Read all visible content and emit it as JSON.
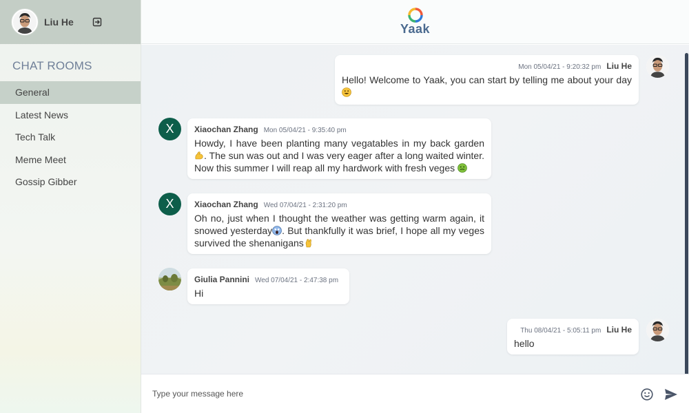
{
  "user": {
    "name": "Liu He"
  },
  "app": {
    "name": "Yaak"
  },
  "sidebar": {
    "title": "CHAT ROOMS",
    "rooms": [
      {
        "label": "General",
        "active": true
      },
      {
        "label": "Latest News"
      },
      {
        "label": "Tech Talk"
      },
      {
        "label": "Meme Meet"
      },
      {
        "label": "Gossip Gibber"
      }
    ]
  },
  "messages": [
    {
      "sender": "Liu He",
      "time": "Mon 05/04/21 - 9:20:32 pm",
      "text": "Hello! Welcome to Yaak, you can start by telling me about your day",
      "emoji": "grinning-face",
      "own": true
    },
    {
      "sender": "Xiaochan Zhang",
      "avatar_letter": "X",
      "time": "Mon 05/04/21 - 9:35:40 pm",
      "text_1": "Howdy, I have been planting many vegatables in my back garden",
      "emoji_1": "flexed-biceps",
      "text_2": ". The sun was out and I was very eager after a long waited winter. Now this summer I will reap all my hardwork with fresh veges",
      "emoji_2": "nauseated-face"
    },
    {
      "sender": "Xiaochan Zhang",
      "avatar_letter": "X",
      "time": "Wed 07/04/21 - 2:31:20 pm",
      "text_1": "Oh no, just when I thought the weather was getting warm again, it snowed yesterday",
      "emoji_1": "screaming-face",
      "text_2": ". But thankfully it was brief, I hope all my veges survived the shenanigans",
      "emoji_2": "crossed-fingers"
    },
    {
      "sender": "Giulia Pannini",
      "time": "Wed 07/04/21 - 2:47:38 pm",
      "text": "Hi"
    },
    {
      "sender": "Liu He",
      "time": "Thu 08/04/21 - 5:05:11 pm",
      "text": "hello",
      "own": true
    }
  ],
  "composer": {
    "placeholder": "Type your message here"
  },
  "colors": {
    "accent": "#0d5e4a",
    "sidebar_active": "#c6d1c9",
    "title": "#6f7f98",
    "logo": "#4a6a8f"
  }
}
